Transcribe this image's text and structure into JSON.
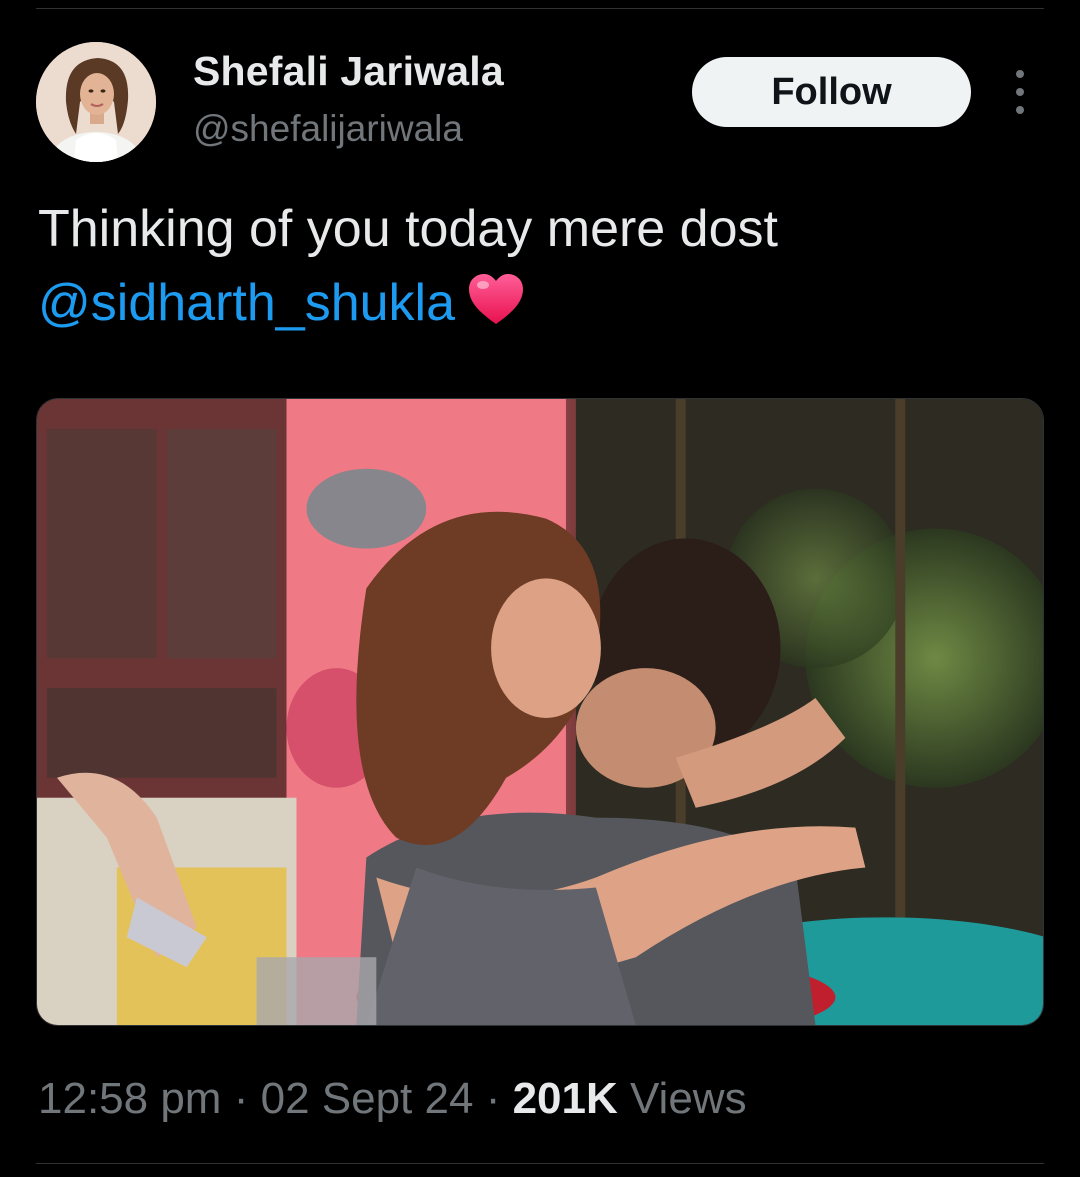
{
  "tweet": {
    "author": {
      "display_name": "Shefali Jariwala",
      "handle": "@shefalijariwala",
      "avatar_icon": "profile-photo"
    },
    "follow_label": "Follow",
    "more_icon": "more-vertical-icon",
    "text_line1": "Thinking of you today mere dost",
    "mention": "@sidharth_shukla",
    "emoji": "heart-icon",
    "media": {
      "type": "photo",
      "icon": "photo-image"
    },
    "time": "12:58 pm",
    "separator": "·",
    "date": "02 Sept 24",
    "views_count": "201K",
    "views_label": "Views"
  },
  "colors": {
    "background": "#000000",
    "text_primary": "#e7e9ea",
    "text_secondary": "#71767b",
    "link": "#1d9bf0",
    "follow_bg": "#eff3f4",
    "heart": "#f91880"
  }
}
